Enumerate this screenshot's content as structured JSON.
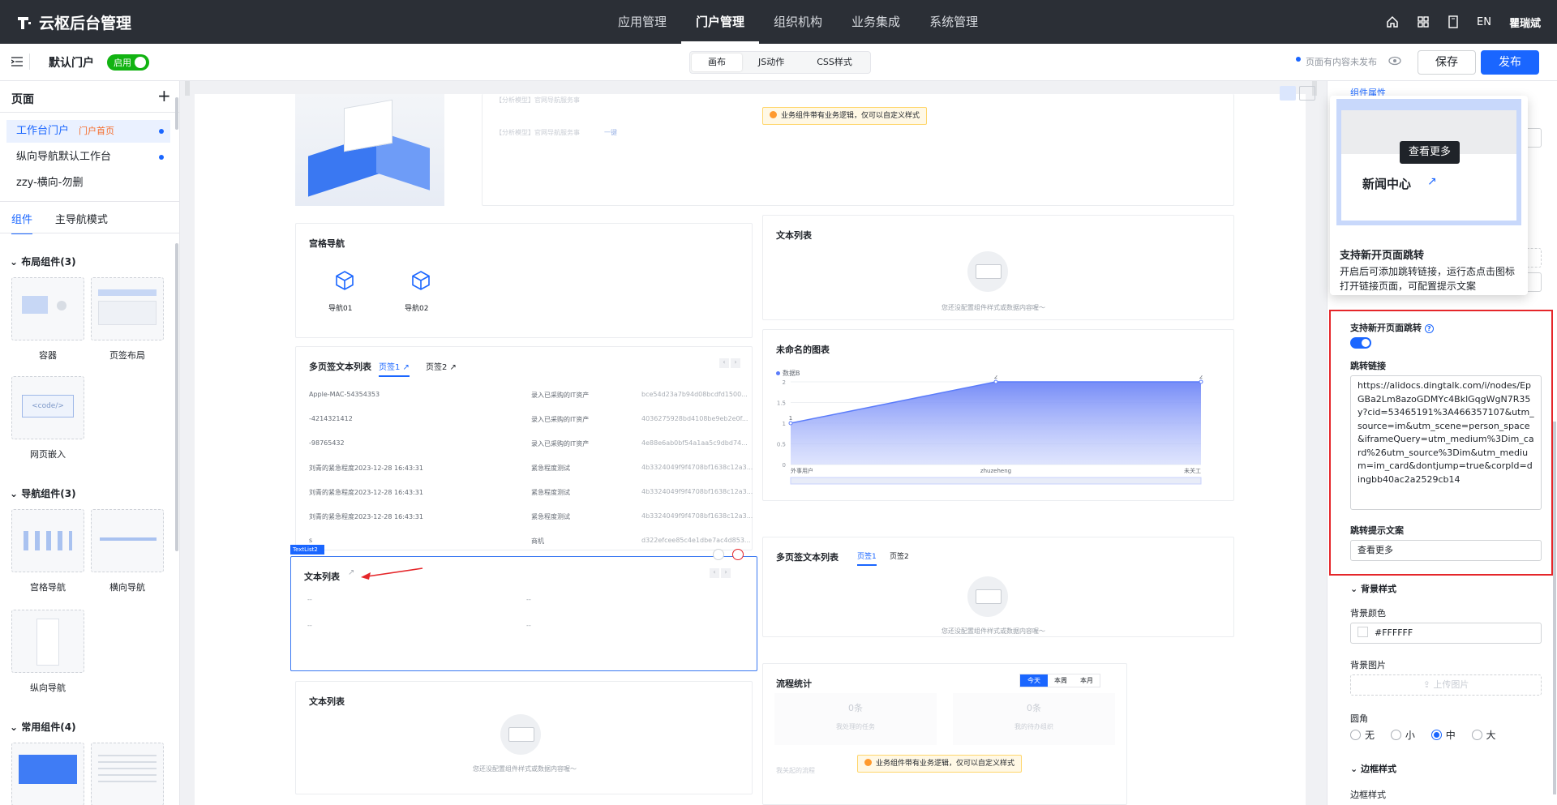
{
  "header": {
    "logo": "云枢后台管理",
    "nav": [
      "应用管理",
      "门户管理",
      "组织机构",
      "业务集成",
      "系统管理"
    ],
    "active": "门户管理",
    "lang": "EN",
    "user": "瞿瑞斌"
  },
  "toolbar": {
    "portal": "默认门户",
    "toggle": "启用",
    "tabs": [
      "画布",
      "JS动作",
      "CSS样式"
    ],
    "active_tab": "画布",
    "status": "页面有内容未发布",
    "save": "保存",
    "publish": "发布"
  },
  "sidebar": {
    "pages_title": "页面",
    "add": "+",
    "pages": [
      {
        "name": "工作台门户",
        "tag": "门户首页"
      },
      {
        "name": "纵向导航默认工作台"
      },
      {
        "name": "zzy-横向-勿删"
      }
    ],
    "tabs": [
      "组件",
      "主导航模式"
    ],
    "groups": [
      {
        "name": "布局组件(3)",
        "items": [
          "容器",
          "页签布局",
          "网页嵌入"
        ]
      },
      {
        "name": "导航组件(3)",
        "items": [
          "宫格导航",
          "横向导航",
          "纵向导航"
        ]
      },
      {
        "name": "常用组件(4)",
        "items": [
          "",
          ""
        ]
      }
    ],
    "code_tag": "<code/>"
  },
  "canvas": {
    "hero_lines": [
      "【分析模型】官网导航服务事",
      "【分析模型】官网导航服务事"
    ],
    "hero_tag": "一键",
    "warn1": "业务组件带有业务逻辑，仅可以自定义样式",
    "grid_nav": {
      "title": "宫格导航",
      "items": [
        "导航01",
        "导航02"
      ]
    },
    "text_list1": {
      "title": "文本列表",
      "empty": "您还没配置组件样式或数据内容喔～"
    },
    "multi_tab": {
      "title": "多页签文本列表",
      "tabs": [
        "页签1",
        "页签2"
      ],
      "rows": [
        [
          "Apple-MAC-54354353",
          "录入已采购的IT资产",
          "bce54d23a7b94d08bcdfd1500..."
        ],
        [
          "-4214321412",
          "录入已采购的IT资产",
          "4036275928bd4108be9eb2e0f..."
        ],
        [
          "-98765432",
          "录入已采购的IT资产",
          "4e88e6ab0bf54a1aa5c9dbd74..."
        ],
        [
          "刘青的紧急程度2023-12-28 16:43:31",
          "紧急程度测试",
          "4b3324049f9f4708bf1638c12a3..."
        ],
        [
          "刘青的紧急程度2023-12-28 16:43:31",
          "紧急程度测试",
          "4b3324049f9f4708bf1638c12a3..."
        ],
        [
          "刘青的紧急程度2023-12-28 16:43:31",
          "紧急程度测试",
          "4b3324049f9f4708bf1638c12a3..."
        ],
        [
          "s",
          "商机",
          "d322efcee85c4e1dbe7ac4d853..."
        ]
      ]
    },
    "chart": {
      "title": "未命名的图表",
      "legend": "数据B"
    },
    "selected": {
      "tag": "TextList2",
      "title": "文本列表",
      "dash": "--"
    },
    "text_list3": {
      "title": "文本列表",
      "empty": "您还没配置组件样式或数据内容喔～"
    },
    "multi_tab2": {
      "title": "多页签文本列表",
      "tabs": [
        "页签1",
        "页签2"
      ],
      "empty": "您还没配置组件样式或数据内容喔～"
    },
    "flow": {
      "title": "流程统计",
      "filters": [
        "今天",
        "本周",
        "本月"
      ],
      "counts": [
        "0条",
        "0条"
      ],
      "labels": [
        "我处理的任务",
        "我的待办组织"
      ],
      "footer": "我关起的流程",
      "warn": "业务组件带有业务逻辑，仅可以自定义样式"
    }
  },
  "chart_data": {
    "type": "area",
    "categories": [
      "外事用户",
      "zhuzeheng",
      "未关工"
    ],
    "series": [
      {
        "name": "数据B",
        "values": [
          1,
          2,
          2
        ]
      }
    ],
    "yticks": [
      0,
      0.5,
      1,
      1.5,
      2
    ],
    "ylim": [
      0,
      2
    ],
    "title": "未命名的图表",
    "xlabel": "",
    "ylabel": ""
  },
  "props": {
    "section": "组件属性",
    "tip": {
      "preview_title": "新闻中心",
      "more": "查看更多",
      "title": "支持新开页面跳转",
      "desc": "开启后可添加跳转链接，运行态点击图标打开链接页面，可配置提示文案"
    },
    "jump_label": "支持新开页面跳转",
    "link_label": "跳转链接",
    "link": "https://alidocs.dingtalk.com/i/nodes/EpGBa2Lm8azoGDMYc4BklGqgWgN7R35y?cid=53465191%3A466357107&utm_source=im&utm_scene=person_space&iframeQuery=utm_medium%3Dim_card%26utm_source%3Dim&utm_medium=im_card&dontjump=true&corpId=dingbb40ac2a2529cb14",
    "tip_label": "跳转提示文案",
    "tip_value": "查看更多",
    "bg_section": "背景样式",
    "bg_color_label": "背景颜色",
    "bg_color": "#FFFFFF",
    "bg_img_label": "背景图片",
    "upload": "上传图片",
    "radius_label": "圆角",
    "radius_opts": [
      "无",
      "小",
      "中",
      "大"
    ],
    "radius_selected": "中",
    "border_section": "边框样式",
    "border_label": "边框样式"
  },
  "colors": {
    "accent": "#1a66ff",
    "top": "#2b2f36",
    "danger": "#e5262a"
  }
}
